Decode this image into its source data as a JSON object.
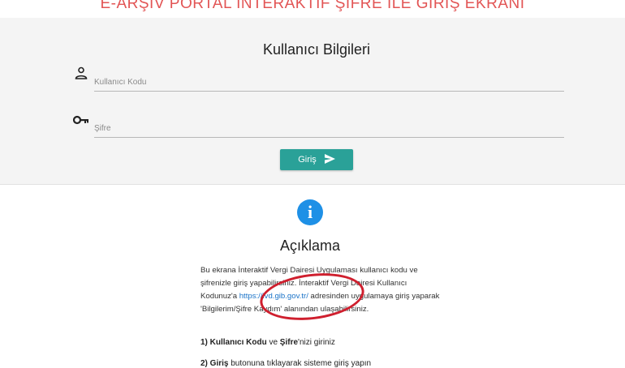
{
  "page": {
    "title": "E-ARŞİV PORTAL İNTERAKTİF ŞİFRE İLE GİRİŞ EKRANI"
  },
  "login": {
    "heading": "Kullanıcı Bilgileri",
    "username_placeholder": "Kullanıcı Kodu",
    "password_placeholder": "Şifre",
    "submit_label": "Giriş"
  },
  "info": {
    "icon": "info-icon",
    "heading": "Açıklama",
    "text_before_link": "Bu ekrana İnteraktif Vergi Dairesi Uygulaması kullanıcı kodu ve şifrenizle giriş yapabilirsiniz. İnteraktif Vergi Dairesi Kullanıcı Kodunuz'a ",
    "link": "https://ivd.gib.gov.tr/",
    "text_after_link": " adresinden uygulamaya giriş yaparak 'Bilgilerim/Şifre Kaydım' alanından ulaşabilirsiniz.",
    "step1_prefix": "1) ",
    "step1_bold1": "Kullanıcı Kodu",
    "step1_mid": " ve ",
    "step1_bold2": "Şifre",
    "step1_suffix": "'nizi giriniz",
    "step2_prefix": "2) ",
    "step2_bold": "Giriş",
    "step2_suffix": " butonuna tıklayarak sisteme giriş yapın"
  },
  "colors": {
    "title": "#e25555",
    "button": "#2aa198",
    "info_icon": "#1e90e6",
    "highlight": "#cf1f2e"
  }
}
